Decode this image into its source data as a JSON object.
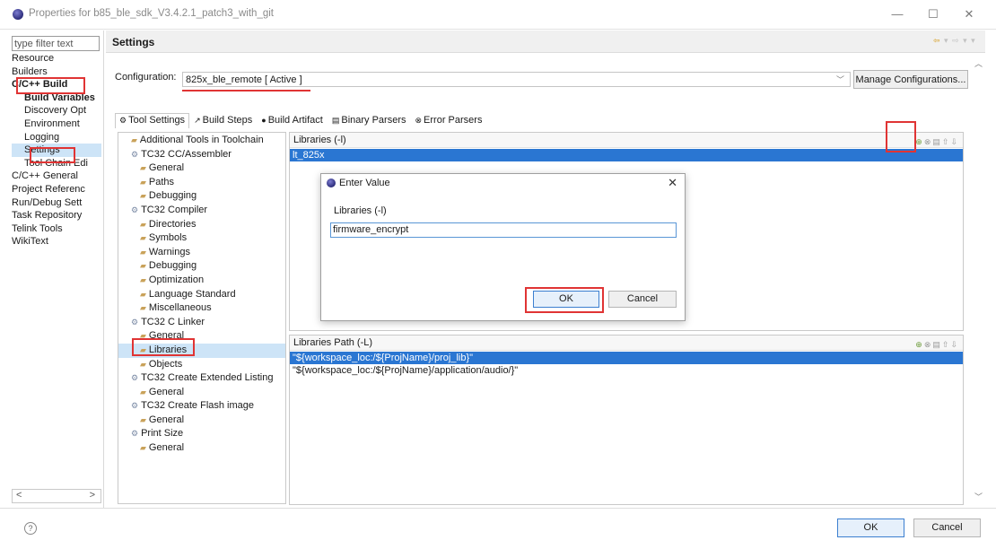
{
  "window": {
    "title": "Properties for b85_ble_sdk_V3.4.2.1_patch3_with_git",
    "min_glyph": "—",
    "max_glyph": "☐",
    "close_glyph": "✕"
  },
  "left_nav": {
    "filter_placeholder": "type filter text",
    "items": [
      {
        "label": "Resource",
        "level": 0
      },
      {
        "label": "Builders",
        "level": 0
      },
      {
        "label": "C/C++ Build",
        "level": 0
      },
      {
        "label": "Build Variables",
        "level": 1
      },
      {
        "label": "Discovery Opt",
        "level": 1
      },
      {
        "label": "Environment",
        "level": 1
      },
      {
        "label": "Logging",
        "level": 1
      },
      {
        "label": "Settings",
        "level": 1
      },
      {
        "label": "Tool Chain Edi",
        "level": 1
      },
      {
        "label": "C/C++ General",
        "level": 0
      },
      {
        "label": "Project Referenc",
        "level": 0
      },
      {
        "label": "Run/Debug Sett",
        "level": 0
      },
      {
        "label": "Task Repository",
        "level": 0
      },
      {
        "label": "Telink Tools",
        "level": 0
      },
      {
        "label": "WikiText",
        "level": 0
      }
    ],
    "scroll_left": "<",
    "scroll_right": ">"
  },
  "settings": {
    "header": "Settings",
    "config_label": "Configuration:",
    "config_value": "825x_ble_remote  [ Active ]",
    "manage_button": "Manage Configurations...",
    "tabs": [
      {
        "label": "Tool Settings",
        "icon": "⚙"
      },
      {
        "label": "Build Steps",
        "icon": "↗"
      },
      {
        "label": "Build Artifact",
        "icon": "●"
      },
      {
        "label": "Binary Parsers",
        "icon": "▤"
      },
      {
        "label": "Error Parsers",
        "icon": "⊗"
      }
    ],
    "tree": [
      {
        "label": "Additional Tools in Toolchain",
        "level": 0,
        "kind": "option"
      },
      {
        "label": "TC32 CC/Assembler",
        "level": 0,
        "kind": "tool"
      },
      {
        "label": "General",
        "level": 1,
        "kind": "option"
      },
      {
        "label": "Paths",
        "level": 1,
        "kind": "option"
      },
      {
        "label": "Debugging",
        "level": 1,
        "kind": "option"
      },
      {
        "label": "TC32 Compiler",
        "level": 0,
        "kind": "tool"
      },
      {
        "label": "Directories",
        "level": 1,
        "kind": "option"
      },
      {
        "label": "Symbols",
        "level": 1,
        "kind": "option"
      },
      {
        "label": "Warnings",
        "level": 1,
        "kind": "option"
      },
      {
        "label": "Debugging",
        "level": 1,
        "kind": "option"
      },
      {
        "label": "Optimization",
        "level": 1,
        "kind": "option"
      },
      {
        "label": "Language Standard",
        "level": 1,
        "kind": "option"
      },
      {
        "label": "Miscellaneous",
        "level": 1,
        "kind": "option"
      },
      {
        "label": "TC32 C Linker",
        "level": 0,
        "kind": "tool"
      },
      {
        "label": "General",
        "level": 1,
        "kind": "option"
      },
      {
        "label": "Libraries",
        "level": 1,
        "kind": "option"
      },
      {
        "label": "Objects",
        "level": 1,
        "kind": "option"
      },
      {
        "label": "TC32 Create Extended Listing",
        "level": 0,
        "kind": "tool"
      },
      {
        "label": "General",
        "level": 1,
        "kind": "option"
      },
      {
        "label": "TC32 Create Flash image",
        "level": 0,
        "kind": "tool"
      },
      {
        "label": "General",
        "level": 1,
        "kind": "option"
      },
      {
        "label": "Print Size",
        "level": 0,
        "kind": "tool"
      },
      {
        "label": "General",
        "level": 1,
        "kind": "option"
      }
    ],
    "libraries": {
      "header": "Libraries (-l)",
      "items": [
        "lt_825x"
      ]
    },
    "library_paths": {
      "header": "Libraries Path (-L)",
      "items": [
        "\"${workspace_loc:/${ProjName}/proj_lib}\"",
        "\"${workspace_loc:/${ProjName}/application/audio/}\""
      ]
    }
  },
  "dialog": {
    "title": "Enter Value",
    "label": "Libraries (-l)",
    "input_value": "firmware_encrypt",
    "ok": "OK",
    "cancel": "Cancel",
    "close_glyph": "✕"
  },
  "bottom": {
    "help_glyph": "?",
    "ok": "OK",
    "cancel": "Cancel"
  },
  "colors": {
    "selection_blue": "#2a76d2",
    "annotation_red": "#e03434"
  }
}
